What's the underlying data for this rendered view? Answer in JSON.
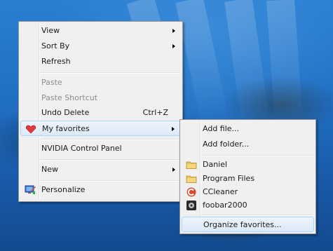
{
  "context_menu": {
    "items": [
      {
        "label": "View",
        "submenu": true,
        "enabled": true
      },
      {
        "label": "Sort By",
        "submenu": true,
        "enabled": true
      },
      {
        "label": "Refresh",
        "enabled": true
      },
      {
        "label": "Paste",
        "enabled": false
      },
      {
        "label": "Paste Shortcut",
        "enabled": false
      },
      {
        "label": "Undo Delete",
        "shortcut": "Ctrl+Z",
        "enabled": true
      },
      {
        "label": "My favorites",
        "submenu": true,
        "enabled": true,
        "highlighted": true,
        "icon": "heart-icon"
      },
      {
        "label": "NVIDIA Control Panel",
        "enabled": true
      },
      {
        "label": "New",
        "submenu": true,
        "enabled": true
      },
      {
        "label": "Personalize",
        "enabled": true,
        "icon": "personalize-icon"
      }
    ]
  },
  "favorites_submenu": {
    "items": [
      {
        "label": "Add file...",
        "enabled": true
      },
      {
        "label": "Add folder...",
        "enabled": true
      },
      {
        "label": "Daniel",
        "icon": "folder-icon"
      },
      {
        "label": "Program Files",
        "icon": "folder-icon"
      },
      {
        "label": "CCleaner",
        "icon": "ccleaner-icon"
      },
      {
        "label": "foobar2000",
        "icon": "foobar2000-icon"
      },
      {
        "label": "Organize favorites...",
        "highlighted": true
      }
    ]
  },
  "colors": {
    "menu_bg": "#f0f0f0",
    "highlight_border": "#a8d8fb",
    "heart": "#e03a3a",
    "folder": "#e8c25a"
  }
}
